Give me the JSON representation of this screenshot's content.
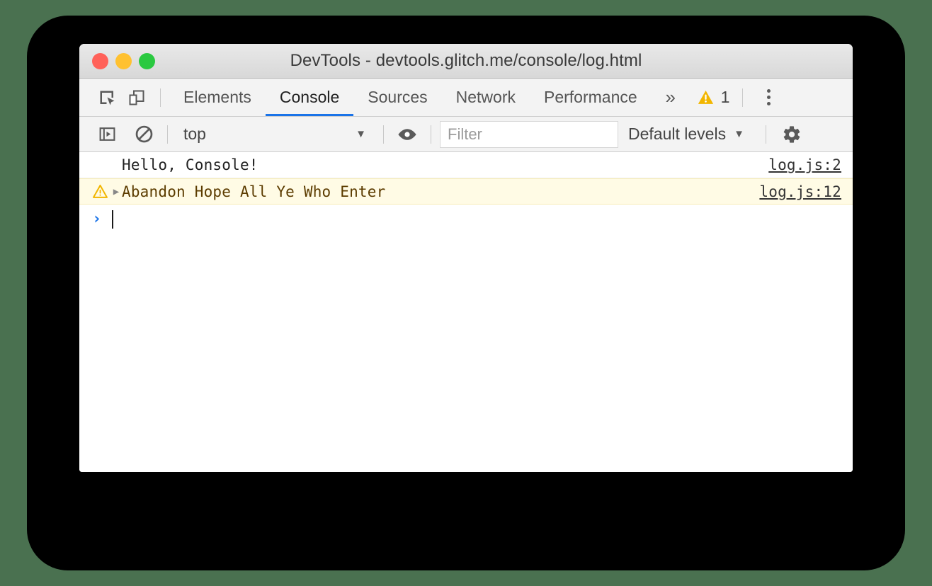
{
  "window": {
    "title": "DevTools - devtools.glitch.me/console/log.html",
    "traffic_lights": [
      {
        "name": "close",
        "color": "#ff6159"
      },
      {
        "name": "minimize",
        "color": "#ffc130"
      },
      {
        "name": "maximize",
        "color": "#2ac940"
      }
    ]
  },
  "colors": {
    "backdrop": "#4a7150",
    "device_body": "#000000",
    "accent_blue": "#1a73e8",
    "warning_amber": "#f2b600",
    "warning_row_bg": "#fffbe5",
    "warning_row_border": "#f7edb8",
    "warning_text": "#5c3c00"
  },
  "tabbar": {
    "icons": [
      {
        "name": "inspect-element-icon",
        "label": "Inspect element"
      },
      {
        "name": "device-toolbar-icon",
        "label": "Toggle device toolbar"
      }
    ],
    "tabs": [
      {
        "label": "Elements",
        "active": false
      },
      {
        "label": "Console",
        "active": true
      },
      {
        "label": "Sources",
        "active": false
      },
      {
        "label": "Network",
        "active": false
      },
      {
        "label": "Performance",
        "active": false
      }
    ],
    "overflow_label": "»",
    "warning_count": "1",
    "kebab_label": "Customize and control DevTools"
  },
  "console_toolbar": {
    "sidebar_toggle_label": "Show console sidebar",
    "clear_label": "Clear console",
    "context": {
      "value": "top",
      "caret": "▼"
    },
    "live_expression_label": "Create live expression",
    "filter": {
      "value": "",
      "placeholder": "Filter"
    },
    "levels": {
      "value": "Default levels",
      "caret": "▼"
    },
    "settings_label": "Console settings"
  },
  "console_messages": [
    {
      "level": "log",
      "icon": "",
      "expander": "",
      "text": "Hello, Console!",
      "source": "log.js:2"
    },
    {
      "level": "warning",
      "icon": "warning-icon",
      "expander": "▶",
      "text": "Abandon Hope All Ye Who Enter",
      "source": "log.js:12"
    }
  ],
  "prompt": {
    "caret": "›",
    "value": ""
  }
}
